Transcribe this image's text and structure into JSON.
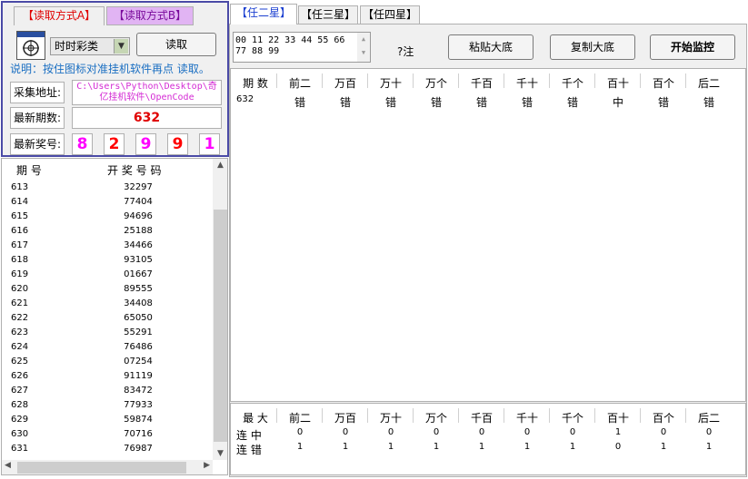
{
  "left": {
    "tab_a": "【读取方式A】",
    "tab_b": "【读取方式B】",
    "combo_value": "时时彩类",
    "read_button": "读取",
    "note": "说明：按住图标对准挂机软件再点 读取。",
    "addr_label": "采集地址:",
    "addr_value": "C:\\Users\\Python\\Desktop\\奇亿挂机软件\\OpenCode",
    "period_label": "最新期数:",
    "period_value": "632",
    "prize_label": "最新奖号:",
    "prize_digits": [
      {
        "v": "8",
        "color": "#ff00ff"
      },
      {
        "v": "2",
        "color": "#ff0000"
      },
      {
        "v": "9",
        "color": "#ff00ff"
      },
      {
        "v": "9",
        "color": "#ff0000"
      },
      {
        "v": "1",
        "color": "#ff00ff"
      }
    ]
  },
  "list": {
    "head_period": "期 号",
    "head_code": "开 奖 号 码",
    "rows": [
      [
        "613",
        "32297"
      ],
      [
        "614",
        "77404"
      ],
      [
        "615",
        "94696"
      ],
      [
        "616",
        "25188"
      ],
      [
        "617",
        "34466"
      ],
      [
        "618",
        "93105"
      ],
      [
        "619",
        "01667"
      ],
      [
        "620",
        "89555"
      ],
      [
        "621",
        "34408"
      ],
      [
        "622",
        "65050"
      ],
      [
        "623",
        "55291"
      ],
      [
        "624",
        "76486"
      ],
      [
        "625",
        "07254"
      ],
      [
        "626",
        "91119"
      ],
      [
        "627",
        "83472"
      ],
      [
        "628",
        "77933"
      ],
      [
        "629",
        "59874"
      ],
      [
        "630",
        "70716"
      ],
      [
        "631",
        "76987"
      ]
    ]
  },
  "right": {
    "tabs": [
      "【任二星】",
      "【任三星】",
      "【任四星】"
    ],
    "numbers_line1": "00 11 22 33 44 55 66",
    "numbers_line2": "77 88 99",
    "count": "?注",
    "btn_paste": "粘贴大底",
    "btn_copy": "复制大底",
    "btn_monitor": "开始监控",
    "columns": [
      "期 数",
      "前二",
      "万百",
      "万十",
      "万个",
      "千百",
      "千十",
      "千个",
      "百十",
      "百个",
      "后二"
    ],
    "row": [
      "632",
      "错",
      "错",
      "错",
      "错",
      "错",
      "错",
      "错",
      "中",
      "错",
      "错"
    ],
    "stats_label": "最 大",
    "stats_columns": [
      "前二",
      "万百",
      "万十",
      "万个",
      "千百",
      "千十",
      "千个",
      "百十",
      "百个",
      "后二"
    ],
    "lz_label": "连 中",
    "lz_values": [
      "0",
      "0",
      "0",
      "0",
      "0",
      "0",
      "0",
      "1",
      "0",
      "0"
    ],
    "lc_label": "连 错",
    "lc_values": [
      "1",
      "1",
      "1",
      "1",
      "1",
      "1",
      "1",
      "0",
      "1",
      "1"
    ]
  }
}
